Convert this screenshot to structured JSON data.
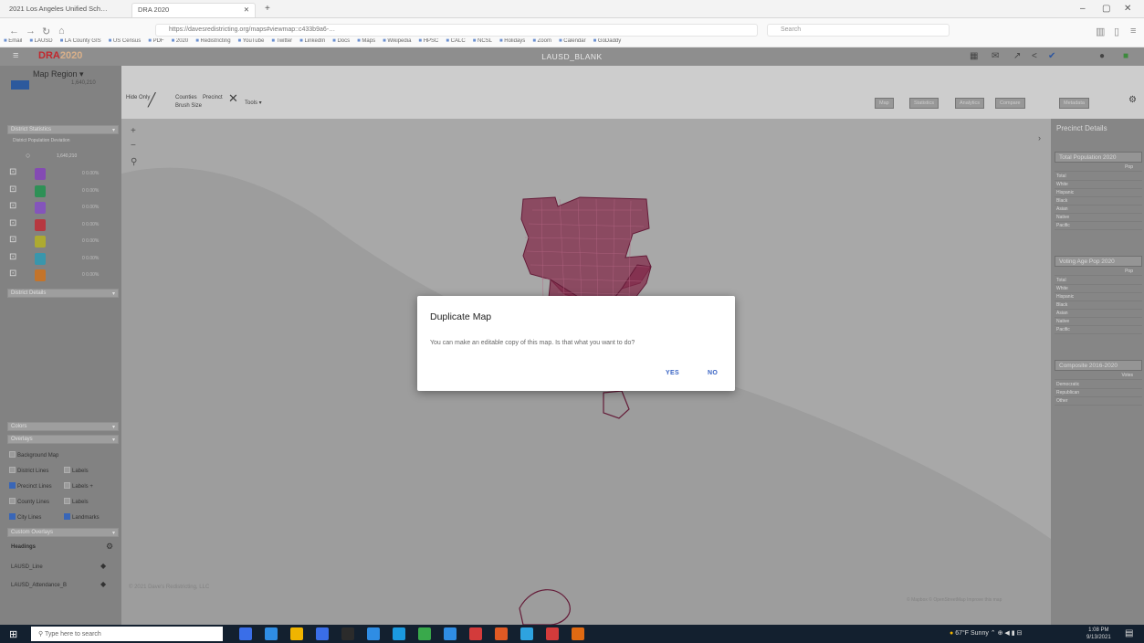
{
  "browser": {
    "tabs": [
      {
        "label": "2021 Los Angeles Unified Sch…"
      },
      {
        "label": "DRA 2020"
      }
    ],
    "url": "https://davesredistricting.org/maps#viewmap::c433b9a6-…",
    "search_placeholder": "Search",
    "bookmarks": [
      "Email",
      "LAUSD",
      "LA County GIS",
      "US Census",
      "PDF",
      "2020",
      "Redistricting",
      "YouTube",
      "Twitter",
      "LinkedIn",
      "Docs",
      "Maps",
      "Wikipedia",
      "HPSC",
      "CALC",
      "NCSL",
      "Holidays",
      "Zoom",
      "Calendar",
      "GoDaddy"
    ]
  },
  "app": {
    "logo_dra": "DRA",
    "logo_year": "2020",
    "map_title": "LAUSD_BLANK",
    "menu_icon": "hamburger-icon"
  },
  "left_panel": {
    "map_region_label": "Map Region",
    "map_region_value": "1,640,210",
    "district_statistics_label": "District Statistics",
    "columns_label": "District  Population  Deviation",
    "unassigned_value": "1,640,210",
    "districts": [
      {
        "color": "#8d4fbf",
        "value": "0  0.00%"
      },
      {
        "color": "#2f9a5b",
        "value": "0  0.00%"
      },
      {
        "color": "#8c5ac8",
        "value": "0  0.00%"
      },
      {
        "color": "#c43a43",
        "value": "0  0.00%"
      },
      {
        "color": "#b9b632",
        "value": "0  0.00%"
      },
      {
        "color": "#3ba0b8",
        "value": "0  0.00%"
      },
      {
        "color": "#d27b2b",
        "value": "0  0.00%"
      }
    ],
    "district_details_label": "District Details",
    "colors_label": "Colors",
    "overlays_label": "Overlays",
    "overlays": [
      {
        "label": "Background Map",
        "checked": false
      },
      {
        "label": "District Lines",
        "checked": false,
        "extra": "Labels"
      },
      {
        "label": "Precinct Lines",
        "checked": true,
        "extra": "Labels +"
      },
      {
        "label": "County Lines",
        "checked": false,
        "extra": "Labels"
      },
      {
        "label": "City Lines",
        "checked": true,
        "extra": "Landmarks"
      }
    ],
    "custom_overlays_label": "Custom Overlays",
    "headings_label": "Headings",
    "overlay_items": [
      "LAUSD_Line",
      "LAUSD_Attendance_B"
    ]
  },
  "toolbar": {
    "select_label": "Hide Only",
    "draw_label": "Brush",
    "counties_label": "Counties",
    "precincts_label": "Precinct",
    "size_label": "Brush Size",
    "tools_label": "Tools"
  },
  "right_buttons": [
    "Map",
    "Statistics",
    "Analytics",
    "Compare",
    "Metadata"
  ],
  "map": {
    "attribution_left": "© 2021 Dave's Redistricting, LLC",
    "attribution_right": "© Mapbox © OpenStreetMap Improve this map"
  },
  "right_panel": {
    "title": "Precinct Details",
    "total_pop_label": "Total Population 2020",
    "total_rows": [
      "Total",
      "White",
      "Hispanic",
      "Black",
      "Asian",
      "Native",
      "Pacific"
    ],
    "vap_label": "Voting Age Pop 2020",
    "vap_rows": [
      "Total",
      "White",
      "Hispanic",
      "Black",
      "Asian",
      "Native",
      "Pacific"
    ],
    "composite_label": "Composite 2016-2020",
    "composite_rows": [
      "Democratic",
      "Republican",
      "Other"
    ],
    "col_pop": "Pop",
    "col_votes": "Votes"
  },
  "dialog": {
    "title": "Duplicate Map",
    "message": "You can make an editable copy of this map. Is that what you want to do?",
    "yes_label": "YES",
    "no_label": "NO"
  },
  "taskbar": {
    "search_placeholder": "Type here to search",
    "weather": "67°F Sunny",
    "time": "1:08 PM",
    "date": "9/13/2021"
  }
}
